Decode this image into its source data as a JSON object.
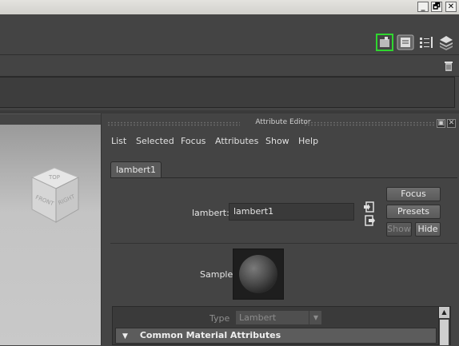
{
  "window_controls": {
    "minimize": "_",
    "restore": "🗗",
    "close": "✕"
  },
  "attribute_editor": {
    "title": "Attribute Editor",
    "menu": [
      "List",
      "Selected",
      "Focus",
      "Attributes",
      "Show",
      "Help"
    ],
    "tab_label": "lambert1",
    "node_label": "lambert:",
    "node_value": "lambert1",
    "buttons": {
      "focus": "Focus",
      "presets": "Presets",
      "show": "Show",
      "hide": "Hide"
    },
    "sample_label": "Sample",
    "type_label": "Type",
    "type_value": "Lambert",
    "section_title": "Common Material Attributes"
  },
  "view_cube": {
    "top": "TOP",
    "front": "FRONT",
    "right": "RIGHT"
  },
  "colors": {
    "panel_bg": "#444444",
    "highlight": "#2fd62f"
  }
}
